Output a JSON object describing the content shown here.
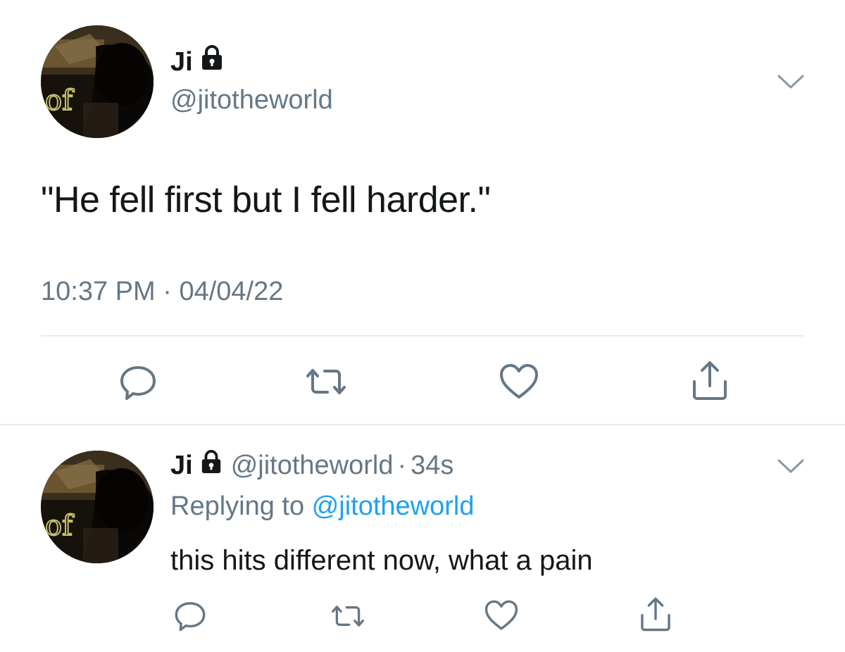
{
  "main_tweet": {
    "author_name": "Ji",
    "handle": "@jitotheworld",
    "text": "\"He fell first but I fell harder.\"",
    "time": "10:37 PM",
    "meta_separator": "·",
    "date": "04/04/22",
    "protected_icon": "lock-icon",
    "menu_icon": "chevron-down-icon",
    "actions": [
      {
        "name": "reply",
        "icon": "reply-icon"
      },
      {
        "name": "retweet",
        "icon": "retweet-icon"
      },
      {
        "name": "like",
        "icon": "heart-icon"
      },
      {
        "name": "share",
        "icon": "share-icon"
      }
    ]
  },
  "reply_tweet": {
    "author_name": "Ji",
    "handle": "@jitotheworld",
    "separator": "·",
    "timestamp": "34s",
    "replying_to_label": "Replying to",
    "replying_to_handle": "@jitotheworld",
    "text": "this hits different now, what a pain",
    "protected_icon": "lock-icon",
    "menu_icon": "chevron-down-icon"
  },
  "colors": {
    "text_primary": "#14171a",
    "text_secondary": "#657786",
    "link": "#1da1f2",
    "divider": "#e6ecf0",
    "icon": "#657786"
  }
}
